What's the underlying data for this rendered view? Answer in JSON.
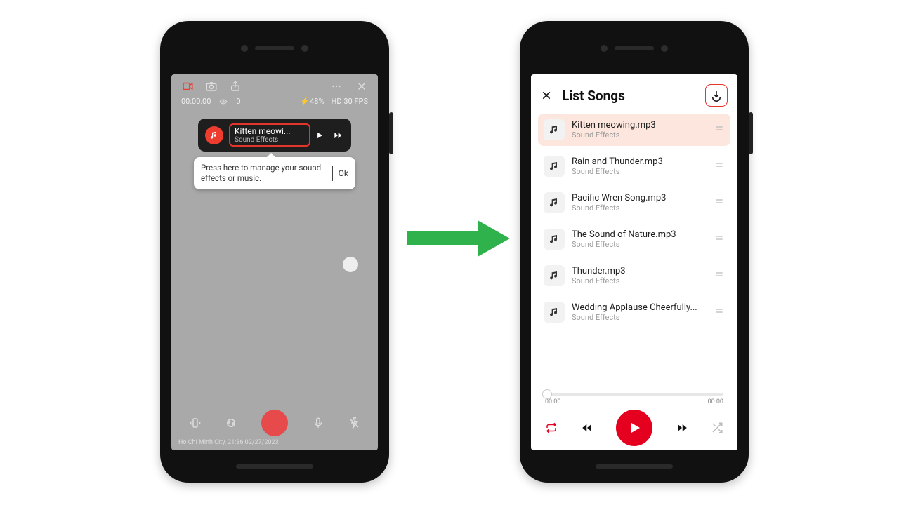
{
  "left": {
    "timecode": "00:00:00",
    "views": "0",
    "battery": "48%",
    "format": "HD 30 FPS",
    "nowplaying_title": "Kitten meowi...",
    "nowplaying_sub": "Sound Effects",
    "tooltip_text": "Press here to manage your sound effects or music.",
    "tooltip_ok": "Ok",
    "watermark": "Ho Chi Minh City, 21:36 02/27/2023"
  },
  "right": {
    "title": "List Songs",
    "seek_start": "00:00",
    "seek_end": "00:00",
    "songs": [
      {
        "title": "Kitten meowing.mp3",
        "sub": "Sound Effects",
        "selected": true
      },
      {
        "title": "Rain and Thunder.mp3",
        "sub": "Sound Effects",
        "selected": false
      },
      {
        "title": "Pacific Wren Song.mp3",
        "sub": "Sound Effects",
        "selected": false
      },
      {
        "title": "The Sound of Nature.mp3",
        "sub": "Sound Effects",
        "selected": false
      },
      {
        "title": "Thunder.mp3",
        "sub": "Sound Effects",
        "selected": false
      },
      {
        "title": "Wedding Applause Cheerfully...",
        "sub": "Sound Effects",
        "selected": false
      }
    ]
  }
}
